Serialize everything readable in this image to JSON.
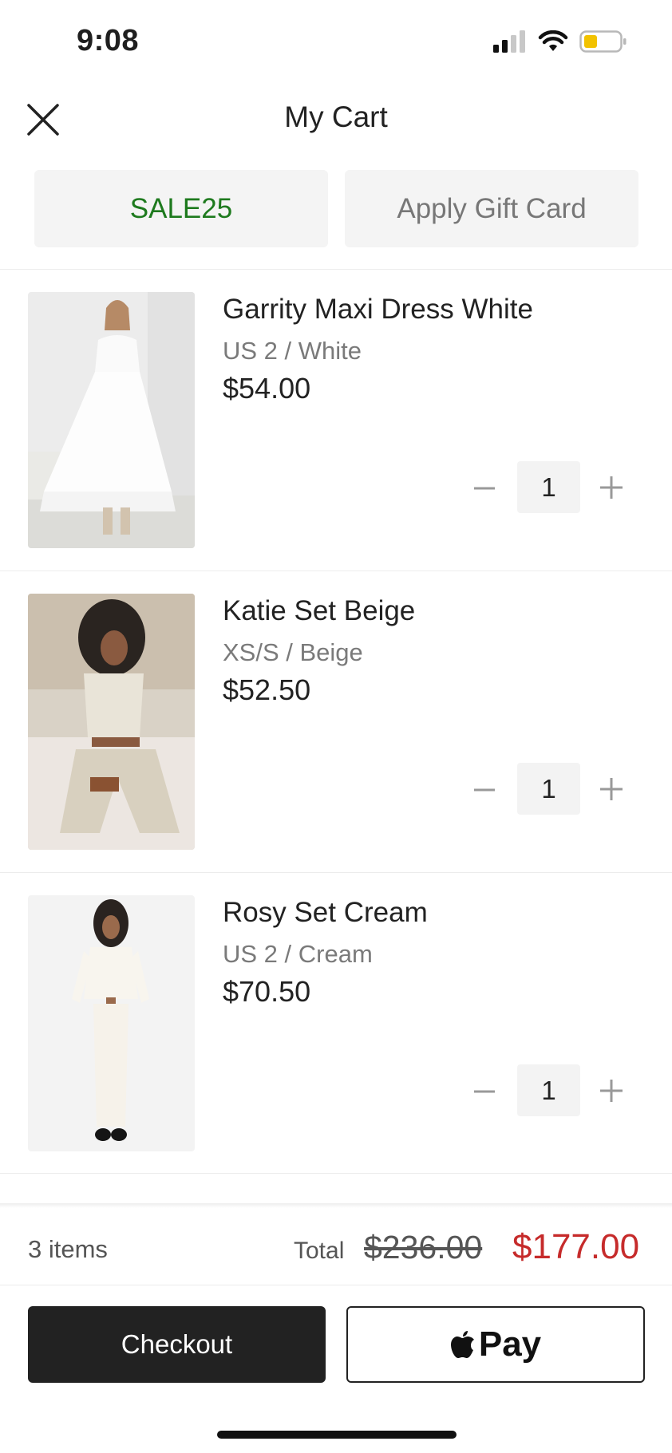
{
  "status_bar": {
    "time": "9:08",
    "battery_color": "#f2c200"
  },
  "header": {
    "title": "My Cart",
    "close_icon": "close-icon"
  },
  "promo": {
    "code": "SALE25",
    "gift_card_label": "Apply Gift Card"
  },
  "items": [
    {
      "name": "Garrity Maxi Dress White",
      "variant": "US 2 / White",
      "price": "$54.00",
      "quantity": "1"
    },
    {
      "name": "Katie Set Beige",
      "variant": "XS/S / Beige",
      "price": "$52.50",
      "quantity": "1"
    },
    {
      "name": "Rosy Set Cream",
      "variant": "US 2 / Cream",
      "price": "$70.50",
      "quantity": "1"
    }
  ],
  "summary": {
    "items_count": "3 items",
    "total_label": "Total",
    "original_total": "$236.00",
    "discounted_total": "$177.00"
  },
  "actions": {
    "checkout_label": "Checkout",
    "applepay_label": "Pay"
  },
  "colors": {
    "promo_green": "#1e7a1e",
    "sale_red": "#c62b2b",
    "dark": "#222222"
  }
}
